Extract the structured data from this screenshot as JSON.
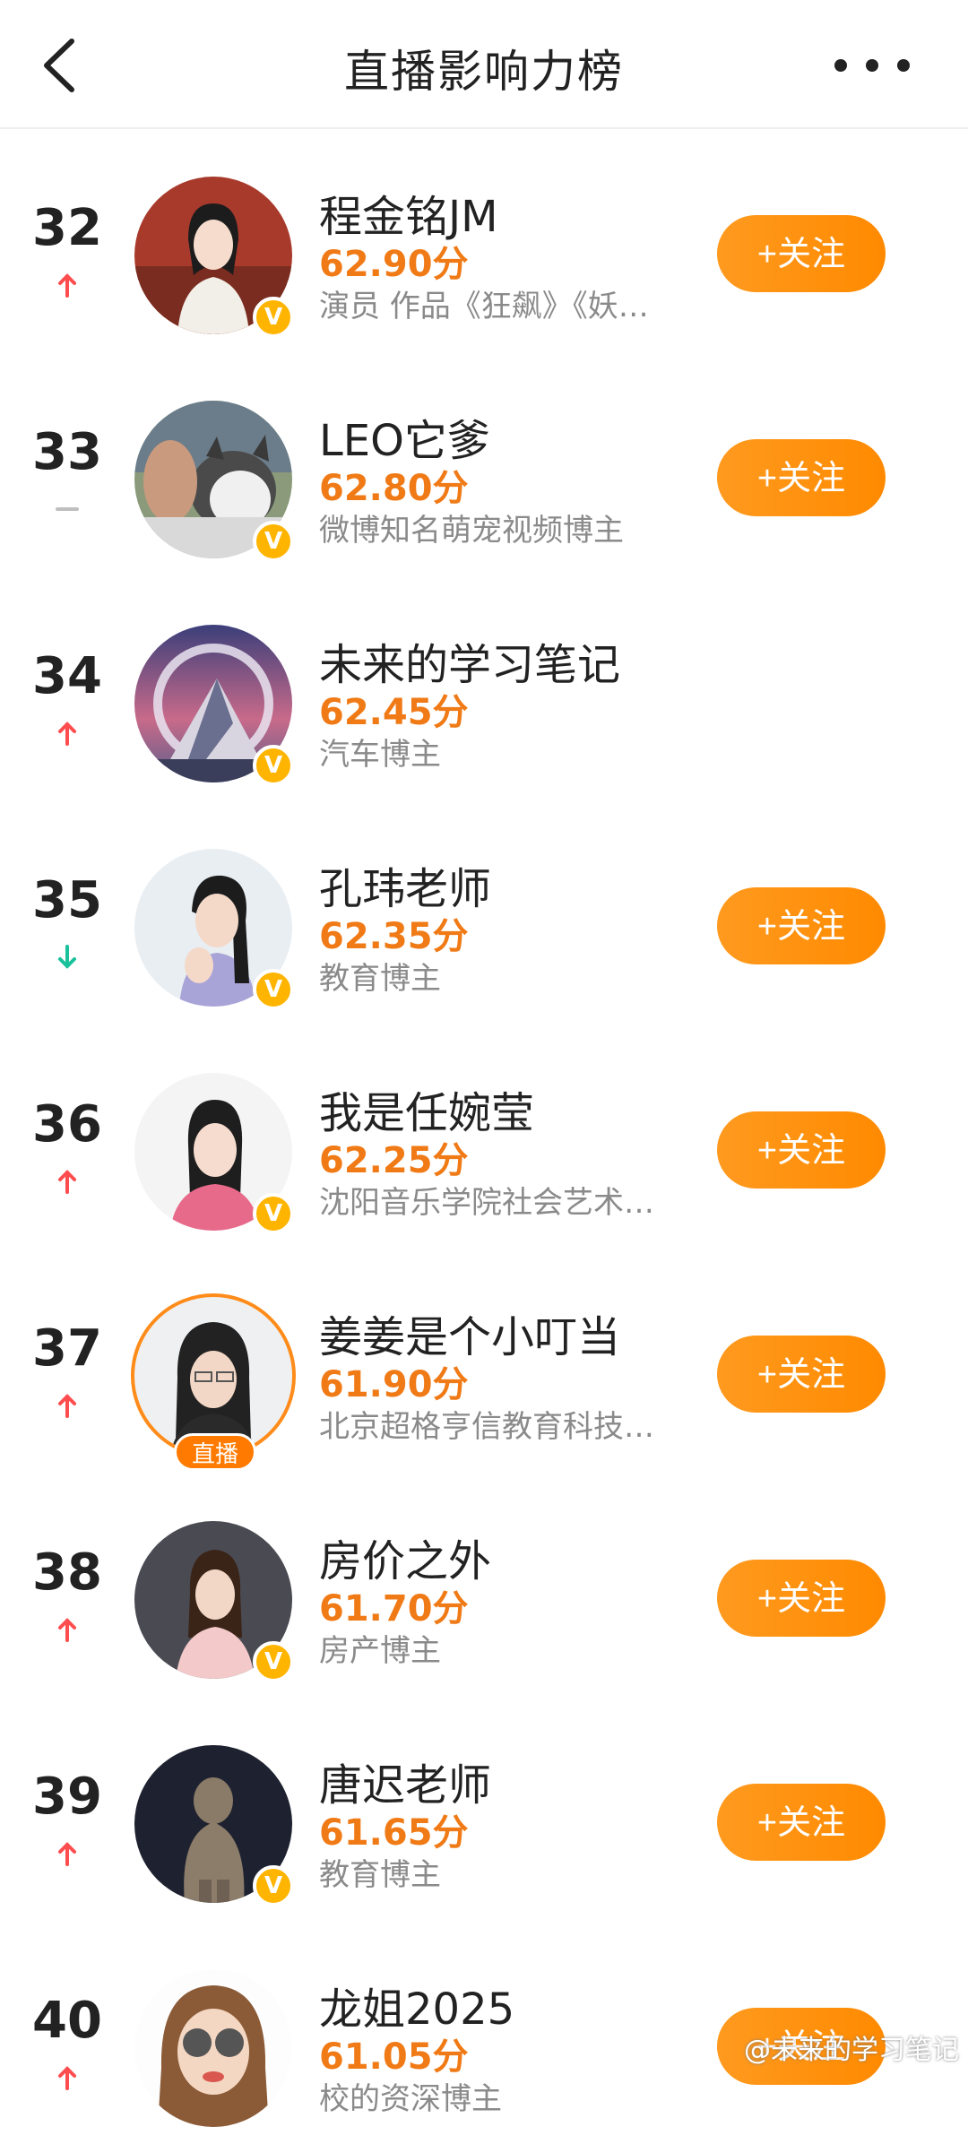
{
  "header": {
    "title": "直播影响力榜"
  },
  "follow_label": "+关注",
  "live_label": "直播",
  "rows": [
    {
      "rank": "32",
      "trend": "up",
      "name": "程金铭JM",
      "score": "62.90分",
      "desc": "演员 作品《狂飙》《妖…",
      "follow": true
    },
    {
      "rank": "33",
      "trend": "same",
      "name": "LEO它爹",
      "score": "62.80分",
      "desc": "微博知名萌宠视频博主",
      "follow": true
    },
    {
      "rank": "34",
      "trend": "up",
      "name": "未来的学习笔记",
      "score": "62.45分",
      "desc": "汽车博主",
      "follow": false
    },
    {
      "rank": "35",
      "trend": "down",
      "name": "孔玮老师",
      "score": "62.35分",
      "desc": "教育博主",
      "follow": true
    },
    {
      "rank": "36",
      "trend": "up",
      "name": "我是任婉莹",
      "score": "62.25分",
      "desc": "沈阳音乐学院社会艺术…",
      "follow": true
    },
    {
      "rank": "37",
      "trend": "up",
      "name": "姜姜是个小叮当",
      "score": "61.90分",
      "desc": "北京超格亨信教育科技…",
      "follow": true,
      "live": true
    },
    {
      "rank": "38",
      "trend": "up",
      "name": "房价之外",
      "score": "61.70分",
      "desc": "房产博主",
      "follow": true
    },
    {
      "rank": "39",
      "trend": "up",
      "name": "唐迟老师",
      "score": "61.65分",
      "desc": "教育博主",
      "follow": true
    },
    {
      "rank": "40",
      "trend": "up",
      "name": "龙姐2025",
      "score": "61.05分",
      "desc": "校的资深博主",
      "follow": true
    }
  ],
  "colors": {
    "accent": "#ff8a00",
    "score": "#f07a16",
    "up": "#ff4d4f",
    "down": "#19c29b",
    "same": "#bfbfbf"
  },
  "watermark": "@未来的学习笔记"
}
